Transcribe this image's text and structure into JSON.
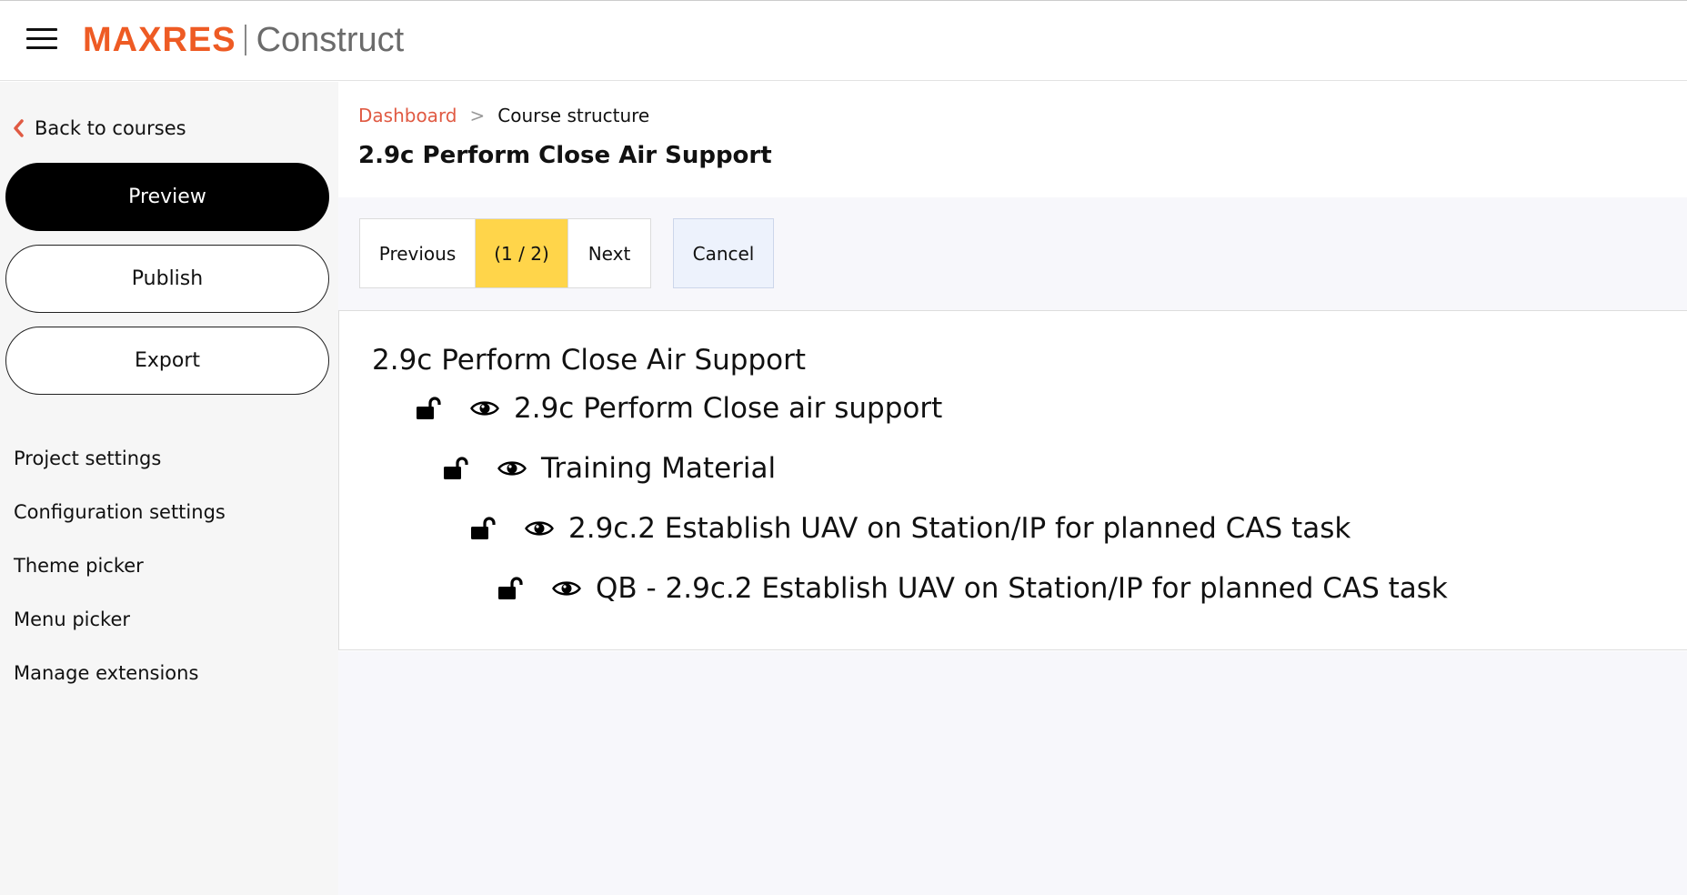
{
  "brand": {
    "name": "MAXRES",
    "product": "Construct",
    "accent_color": "#ee5b24",
    "product_color": "#6b6b6b"
  },
  "sidebar": {
    "back_label": "Back to courses",
    "buttons": {
      "preview": "Preview",
      "publish": "Publish",
      "export": "Export"
    },
    "menu": [
      "Project settings",
      "Configuration settings",
      "Theme picker",
      "Menu picker",
      "Manage extensions"
    ]
  },
  "breadcrumb": {
    "items": [
      "Dashboard",
      "Course structure"
    ],
    "separator": ">",
    "link_color": "#e05a43"
  },
  "page_title": "2.9c Perform Close Air Support",
  "toolbar": {
    "previous": "Previous",
    "counter": "(1 / 2)",
    "next": "Next",
    "cancel": "Cancel",
    "counter_bg": "#ffd54a",
    "cancel_bg": "#edf2fc"
  },
  "tree": {
    "root": "2.9c Perform Close Air Support",
    "nodes": [
      {
        "label": "2.9c Perform Close air support",
        "level": 1,
        "lock": "unlocked-icon",
        "visibility": "eye-icon"
      },
      {
        "label": "Training Material",
        "level": 2,
        "lock": "unlocked-icon",
        "visibility": "eye-icon"
      },
      {
        "label": "2.9c.2 Establish UAV on Station/IP for planned CAS task",
        "level": 3,
        "lock": "unlocked-icon",
        "visibility": "eye-icon"
      },
      {
        "label": "QB - 2.9c.2 Establish UAV on Station/IP for planned CAS task",
        "level": 4,
        "lock": "unlocked-icon",
        "visibility": "eye-icon"
      }
    ]
  }
}
